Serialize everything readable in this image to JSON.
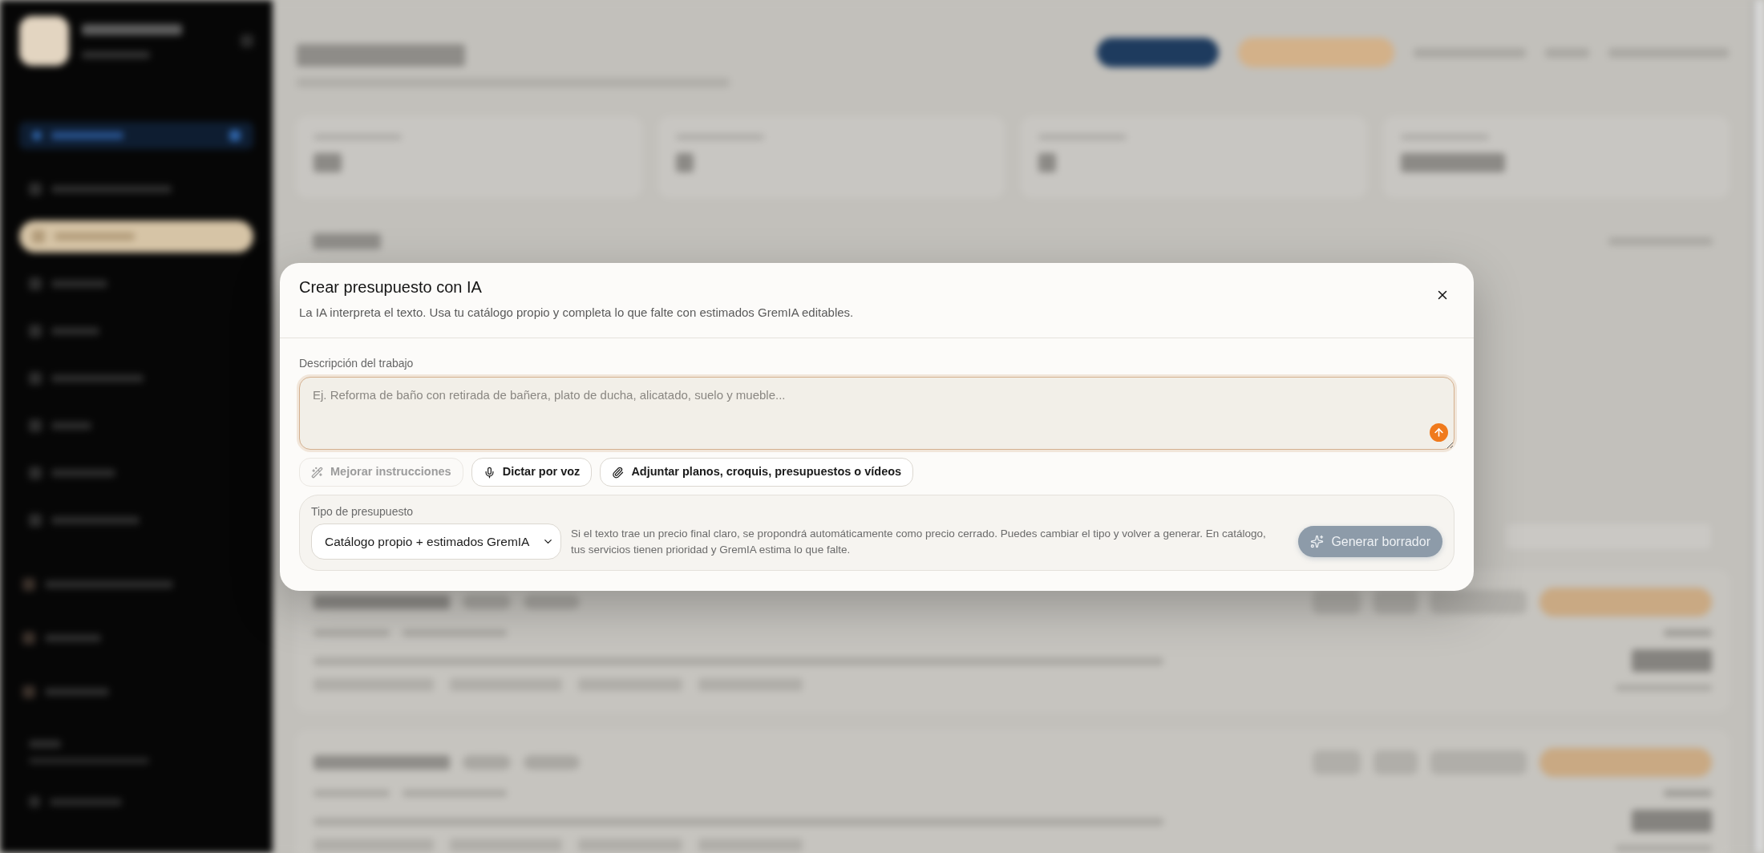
{
  "dialog": {
    "title": "Crear presupuesto con IA",
    "subtitle": "La IA interpreta el texto. Usa tu catálogo propio y completa lo que falte con estimados GremIA editables."
  },
  "description": {
    "label": "Descripción del trabajo",
    "placeholder": "Ej. Reforma de baño con retirada de bañera, plato de ducha, alicatado, suelo y mueble..."
  },
  "actions": [
    {
      "label": "Mejorar instrucciones",
      "disabled": true
    },
    {
      "label": "Dictar por voz",
      "disabled": false
    },
    {
      "label": "Adjuntar planos, croquis, presupuestos o vídeos",
      "disabled": false
    }
  ],
  "budget_type": {
    "label": "Tipo de presupuesto",
    "value": "Catálogo propio + estimados GremIA",
    "help": "Si el texto trae un precio final claro, se propondrá automáticamente como precio cerrado. Puedes cambiar el tipo y volver a generar. En catálogo, tus servicios tienen prioridad y GremIA estima lo que falte.",
    "generate_button": {
      "label": "Generar borrador",
      "disabled": true
    }
  }
}
